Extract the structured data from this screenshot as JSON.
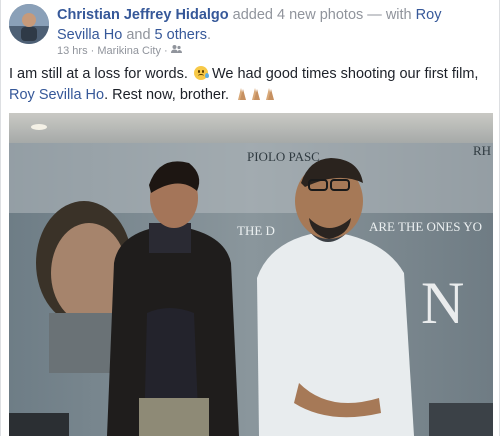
{
  "post": {
    "author": "Christian Jeffrey Hidalgo",
    "action": "added 4 new photos",
    "with_text": "— with",
    "tagged_person": "Roy Sevilla Ho",
    "and_text": "and",
    "others": "5 others",
    "period": ".",
    "time": "13 hrs",
    "separator": "·",
    "location": "Marikina City",
    "separator2": "·",
    "privacy_icon": "friends-icon",
    "caption_part1": "I am still at a loss for words.",
    "caption_part2": "We had good times shooting our first film,",
    "caption_link": "Roy Sevilla Ho",
    "caption_part3": ". Rest now, brother.",
    "emoji_face": "crying-face-emoji",
    "emoji_hands": "praying-hands-emoji"
  },
  "photo": {
    "poster_text_1": "PIOLO PASC",
    "poster_text_2": "RH",
    "poster_text_3": "THE D",
    "poster_text_4": "ARE THE ONES YO",
    "poster_text_5": "N"
  },
  "colors": {
    "link": "#365899",
    "meta": "#90949c",
    "text": "#1d2129"
  }
}
